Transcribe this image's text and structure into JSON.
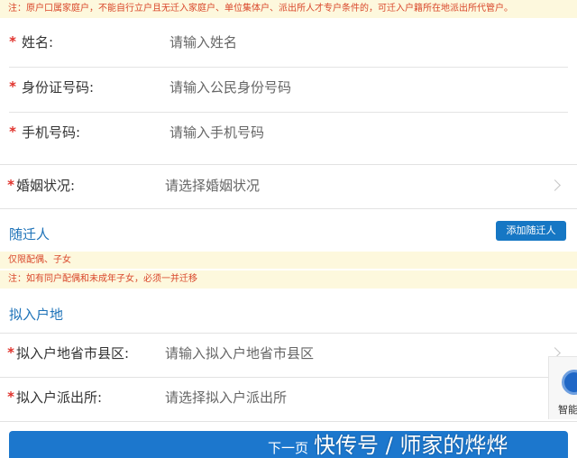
{
  "notice_top": "注：原户口属家庭户，不能自行立户且无迁入家庭户、单位集体户、派出所人才专户条件的，可迁入户籍所在地派出所代管户。",
  "required_mark": "*",
  "fields": [
    {
      "label": "姓名:",
      "placeholder": "请输入姓名"
    },
    {
      "label": "身份证号码:",
      "placeholder": "请输入公民身份号码"
    },
    {
      "label": "手机号码:",
      "placeholder": "请输入手机号码"
    }
  ],
  "marital": {
    "label": "婚姻状况:",
    "placeholder": "请选择婚姻状况"
  },
  "accompany": {
    "title": "随迁人",
    "add_button": "添加随迁人",
    "note1": "仅限配偶、子女",
    "note2": "注：如有同户配偶和未成年子女，必须一并迁移"
  },
  "destination": {
    "title": "拟入户地",
    "region": {
      "label": "拟入户地省市县区:",
      "placeholder": "请输入拟入户地省市县区"
    },
    "station": {
      "label": "拟入户派出所:",
      "placeholder": "请选择拟入户派出所"
    }
  },
  "side_widget_text": "智能",
  "next_button": "下一页",
  "watermark": "快传号 / 师家的烨烨",
  "colors": {
    "accent": "#1677c4",
    "required": "#e0312b",
    "notice_bg": "#fdf8dd",
    "notice_text": "#d9472b"
  }
}
